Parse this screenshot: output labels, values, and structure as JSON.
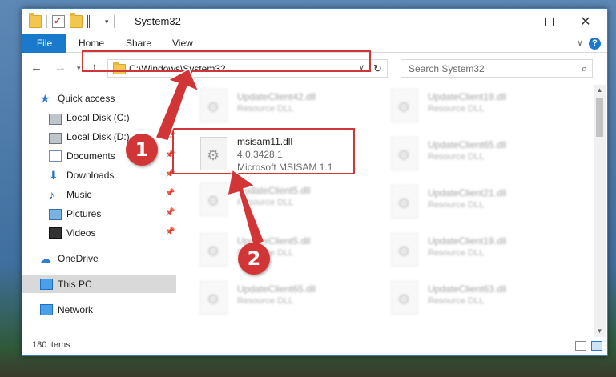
{
  "window": {
    "title": "System32",
    "ribbon_tabs": [
      "File",
      "Home",
      "Share",
      "View"
    ],
    "help_glyph": "?",
    "chevron_glyph": "∨"
  },
  "navbar": {
    "address": "C:\\Windows\\System32",
    "search_placeholder": "Search System32"
  },
  "sidebar": {
    "items": [
      {
        "label": "Quick access",
        "icon": "star-icon"
      },
      {
        "label": "Local Disk (C:)",
        "icon": "drive-icon"
      },
      {
        "label": "Local Disk (D:)",
        "icon": "drive-icon"
      },
      {
        "label": "Documents",
        "icon": "documents-icon"
      },
      {
        "label": "Downloads",
        "icon": "download-icon"
      },
      {
        "label": "Music",
        "icon": "music-icon"
      },
      {
        "label": "Pictures",
        "icon": "pictures-icon"
      },
      {
        "label": "Videos",
        "icon": "videos-icon"
      },
      {
        "label": "OneDrive",
        "icon": "cloud-icon"
      },
      {
        "label": "This PC",
        "icon": "computer-icon"
      },
      {
        "label": "Network",
        "icon": "network-icon"
      }
    ]
  },
  "files": {
    "left_col": [
      {
        "name": "UpdateClient42.dll",
        "type": "Resource DLL"
      },
      {
        "name": "UpdateClient5.dll",
        "type": "Resource DLL"
      },
      {
        "name": "UpdateClient5.dll",
        "type": "Resource DLL"
      },
      {
        "name": "UpdateClient65.dll",
        "type": "Resource DLL"
      }
    ],
    "right_col": [
      {
        "name": "UpdateClient19.dll",
        "type": "Resource DLL"
      },
      {
        "name": "UpdateClient65.dll",
        "type": "Resource DLL"
      },
      {
        "name": "UpdateClient21.dll",
        "type": "Resource DLL"
      },
      {
        "name": "UpdateClient19.dll",
        "type": "Resource DLL"
      },
      {
        "name": "UpdateClient63.dll",
        "type": "Resource DLL"
      }
    ],
    "highlighted": {
      "name": "msisam11.dll",
      "version": "4.0.3428.1",
      "description": "Microsoft MSISAM 1.1"
    }
  },
  "status": {
    "item_count": "180 items"
  },
  "annotations": {
    "step1": "1",
    "step2": "2"
  },
  "colors": {
    "accent": "#1979ca",
    "highlight_red": "#d23535"
  }
}
